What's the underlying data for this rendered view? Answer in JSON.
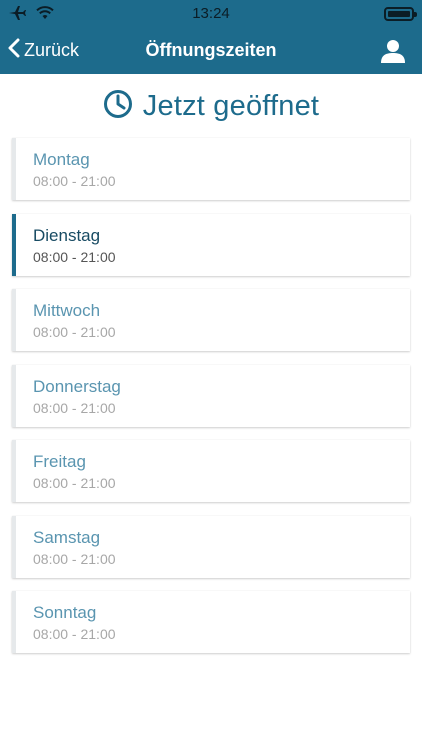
{
  "status_bar": {
    "time": "13:24",
    "icons": [
      "airplane-icon",
      "wifi-icon",
      "battery-icon"
    ]
  },
  "nav": {
    "back_label": "Zurück",
    "title": "Öffnungszeiten",
    "icons": [
      "chevron-left-icon",
      "user-icon"
    ]
  },
  "heading": {
    "icon": "clock-icon",
    "text": "Jetzt geöffnet"
  },
  "days": [
    {
      "name": "Montag",
      "hours": "08:00 - 21:00",
      "active": false
    },
    {
      "name": "Dienstag",
      "hours": "08:00 - 21:00",
      "active": true
    },
    {
      "name": "Mittwoch",
      "hours": "08:00 - 21:00",
      "active": false
    },
    {
      "name": "Donnerstag",
      "hours": "08:00 - 21:00",
      "active": false
    },
    {
      "name": "Freitag",
      "hours": "08:00 - 21:00",
      "active": false
    },
    {
      "name": "Samstag",
      "hours": "08:00 - 21:00",
      "active": false
    },
    {
      "name": "Sonntag",
      "hours": "08:00 - 21:00",
      "active": false
    }
  ],
  "colors": {
    "brand": "#1d6b8c",
    "day_label": "#5a95b0",
    "active_day_label": "#184b63",
    "hours": "#a7a7a7"
  }
}
